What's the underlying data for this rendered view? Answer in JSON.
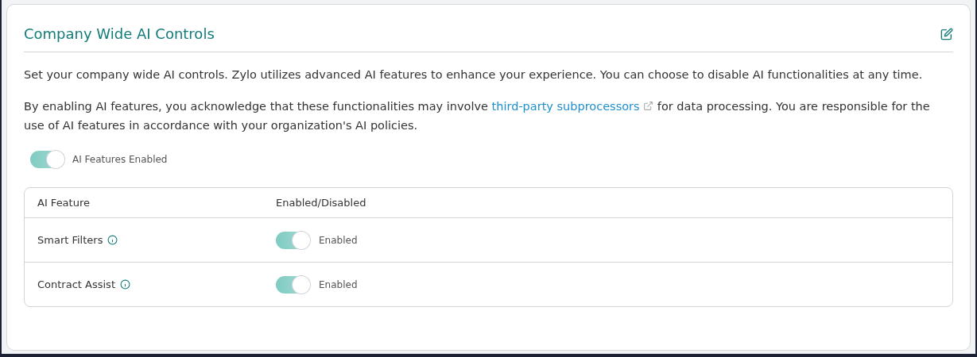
{
  "card": {
    "title": "Company Wide AI Controls"
  },
  "intro": "Set your company wide AI controls. Zylo utilizes advanced AI features to enhance your experience. You can choose to disable AI functionalities at any time.",
  "notice": {
    "before": "By enabling AI features, you acknowledge that these functionalities may involve",
    "link": "third-party subprocessors",
    "after": "for data processing. You are responsible for the use of AI features in accordance with your organization's AI policies."
  },
  "master_toggle": {
    "label": "AI Features Enabled",
    "on": true
  },
  "table": {
    "columns": [
      "AI Feature",
      "Enabled/Disabled"
    ],
    "rows": [
      {
        "feature": "Smart Filters",
        "on": true,
        "status": "Enabled"
      },
      {
        "feature": "Contract Assist",
        "on": true,
        "status": "Enabled"
      }
    ]
  }
}
